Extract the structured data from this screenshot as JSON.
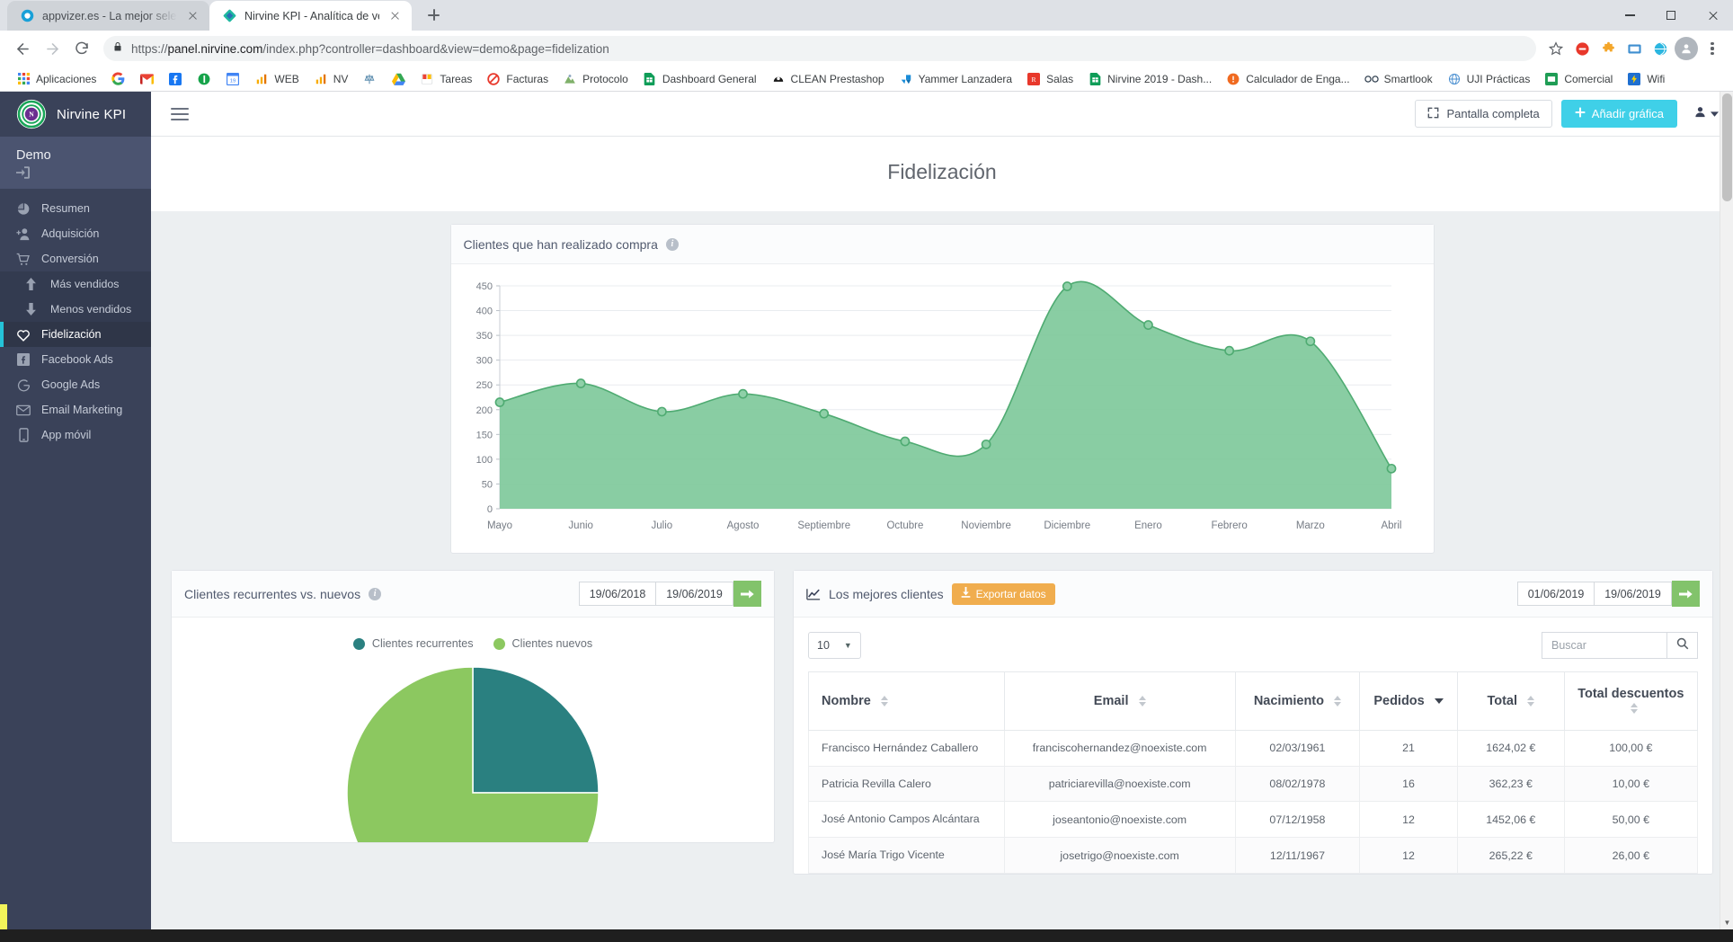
{
  "browser": {
    "tabs": [
      {
        "title": "appvizer.es - La mejor selección d",
        "active": false,
        "favicon": "appvizer-icon"
      },
      {
        "title": "Nirvine KPI - Analítica de ventas",
        "active": true,
        "favicon": "nirvine-icon"
      }
    ],
    "newtab_label": "+",
    "url_secure": "https://",
    "url_host": "panel.nirvine.com",
    "url_path": "/index.php?controller=dashboard&view=demo&page=fidelization",
    "bookmarks": [
      {
        "label": "Aplicaciones",
        "icon": "apps-grid-icon"
      },
      {
        "label": "",
        "icon": "google-icon"
      },
      {
        "label": "",
        "icon": "gmail-icon"
      },
      {
        "label": "",
        "icon": "facebook-icon"
      },
      {
        "label": "",
        "icon": "green-circle-icon"
      },
      {
        "label": "",
        "icon": "calendar-19-icon"
      },
      {
        "label": "WEB",
        "icon": "analytics-icon"
      },
      {
        "label": "NV",
        "icon": "analytics-icon"
      },
      {
        "label": "",
        "icon": "balance-icon"
      },
      {
        "label": "",
        "icon": "google-drive-icon"
      },
      {
        "label": "Tareas",
        "icon": "tasks-icon"
      },
      {
        "label": "Facturas",
        "icon": "no-entry-icon"
      },
      {
        "label": "Protocolo",
        "icon": "mountain-icon"
      },
      {
        "label": "Dashboard General",
        "icon": "sheets-icon"
      },
      {
        "label": "CLEAN Prestashop",
        "icon": "prestashop-icon"
      },
      {
        "label": "Yammer Lanzadera",
        "icon": "yammer-icon"
      },
      {
        "label": "Salas",
        "icon": "red-square-icon"
      },
      {
        "label": "Nirvine 2019 - Dash...",
        "icon": "sheets-icon"
      },
      {
        "label": "Calculador de Enga...",
        "icon": "orange-alert-icon"
      },
      {
        "label": "Smartlook",
        "icon": "smartlook-icon"
      },
      {
        "label": "UJI Prácticas",
        "icon": "globe-icon"
      },
      {
        "label": "Comercial",
        "icon": "green-folder-icon"
      },
      {
        "label": "Wifi",
        "icon": "wifi-bolt-icon"
      }
    ]
  },
  "sidebar": {
    "brand": "Nirvine KPI",
    "account": "Demo",
    "items": [
      {
        "label": "Resumen",
        "icon": "pie-chart-icon",
        "level": "top",
        "active": false
      },
      {
        "label": "Adquisición",
        "icon": "add-user-icon",
        "level": "top",
        "active": false
      },
      {
        "label": "Conversión",
        "icon": "cart-icon",
        "level": "top",
        "active": false
      },
      {
        "label": "Más vendidos",
        "icon": "arrow-up-icon",
        "level": "sub",
        "active": false
      },
      {
        "label": "Menos vendidos",
        "icon": "arrow-down-icon",
        "level": "sub",
        "active": false
      },
      {
        "label": "Fidelización",
        "icon": "heart-icon",
        "level": "top",
        "active": true
      },
      {
        "label": "Facebook Ads",
        "icon": "facebook-icon",
        "level": "top",
        "active": false
      },
      {
        "label": "Google Ads",
        "icon": "google-g-icon",
        "level": "top",
        "active": false
      },
      {
        "label": "Email Marketing",
        "icon": "envelope-icon",
        "level": "top",
        "active": false
      },
      {
        "label": "App móvil",
        "icon": "mobile-icon",
        "level": "top",
        "active": false
      }
    ]
  },
  "topbar": {
    "fullscreen_label": "Pantalla completa",
    "add_chart_label": "Añadir gráfica"
  },
  "page": {
    "title": "Fidelización"
  },
  "area_card": {
    "title": "Clientes que han realizado compra",
    "info": "i"
  },
  "pie_card": {
    "title": "Clientes recurrentes vs. nuevos",
    "info": "i",
    "date_from": "19/06/2018",
    "date_to": "19/06/2019",
    "go": "➜"
  },
  "table_card": {
    "title": "Los mejores clientes",
    "export_label": "Exportar datos",
    "date_from": "01/06/2019",
    "date_to": "19/06/2019",
    "go": "➜",
    "page_length": "10",
    "search_placeholder": "Buscar",
    "columns": [
      {
        "label": "Nombre",
        "sort": "both"
      },
      {
        "label": "Email",
        "sort": "both"
      },
      {
        "label": "Nacimiento",
        "sort": "both"
      },
      {
        "label": "Pedidos",
        "sort": "desc"
      },
      {
        "label": "Total",
        "sort": "both"
      },
      {
        "label": "Total descuentos",
        "sort": "both"
      }
    ],
    "rows": [
      {
        "nombre": "Francisco Hernández Caballero",
        "email": "franciscohernandez@noexiste.com",
        "nacimiento": "02/03/1961",
        "pedidos": "21",
        "total": "1624,02 €",
        "descuentos": "100,00 €"
      },
      {
        "nombre": "Patricia Revilla Calero",
        "email": "patriciarevilla@noexiste.com",
        "nacimiento": "08/02/1978",
        "pedidos": "16",
        "total": "362,23 €",
        "descuentos": "10,00 €"
      },
      {
        "nombre": "José Antonio Campos Alcántara",
        "email": "joseantonio@noexiste.com",
        "nacimiento": "07/12/1958",
        "pedidos": "12",
        "total": "1452,06 €",
        "descuentos": "50,00 €"
      },
      {
        "nombre": "José María Trigo Vicente",
        "email": "josetrigo@noexiste.com",
        "nacimiento": "12/11/1967",
        "pedidos": "12",
        "total": "265,22 €",
        "descuentos": "26,00 €"
      }
    ]
  },
  "colors": {
    "accent_cyan": "#3fd0e8",
    "sidebar_bg": "#3a4259",
    "area_fill": "#7fc99b",
    "area_stroke": "#4fab72",
    "teal": "#2a8080",
    "light_green": "#8cc860",
    "orange": "#f0ad4e",
    "go_green": "#82c36b"
  },
  "chart_data": [
    {
      "type": "area",
      "title": "Clientes que han realizado compra",
      "xlabel": "",
      "ylabel": "",
      "categories": [
        "Mayo",
        "Junio",
        "Julio",
        "Agosto",
        "Septiembre",
        "Octubre",
        "Noviembre",
        "Diciembre",
        "Enero",
        "Febrero",
        "Marzo",
        "Abril"
      ],
      "values": [
        215,
        253,
        196,
        232,
        192,
        136,
        130,
        449,
        371,
        319,
        338,
        81
      ],
      "ylim": [
        0,
        450
      ],
      "yticks": [
        0,
        50,
        100,
        150,
        200,
        250,
        300,
        350,
        400,
        450
      ],
      "grid": true,
      "legend": "none",
      "fill_color": "#7fc99b",
      "line_color": "#4fab72"
    },
    {
      "type": "pie",
      "title": "Clientes recurrentes vs. nuevos",
      "labels": [
        "Clientes recurrentes",
        "Clientes nuevos"
      ],
      "values": [
        25,
        75
      ],
      "colors": [
        "#2a8080",
        "#8cc860"
      ],
      "legend": "top"
    }
  ]
}
